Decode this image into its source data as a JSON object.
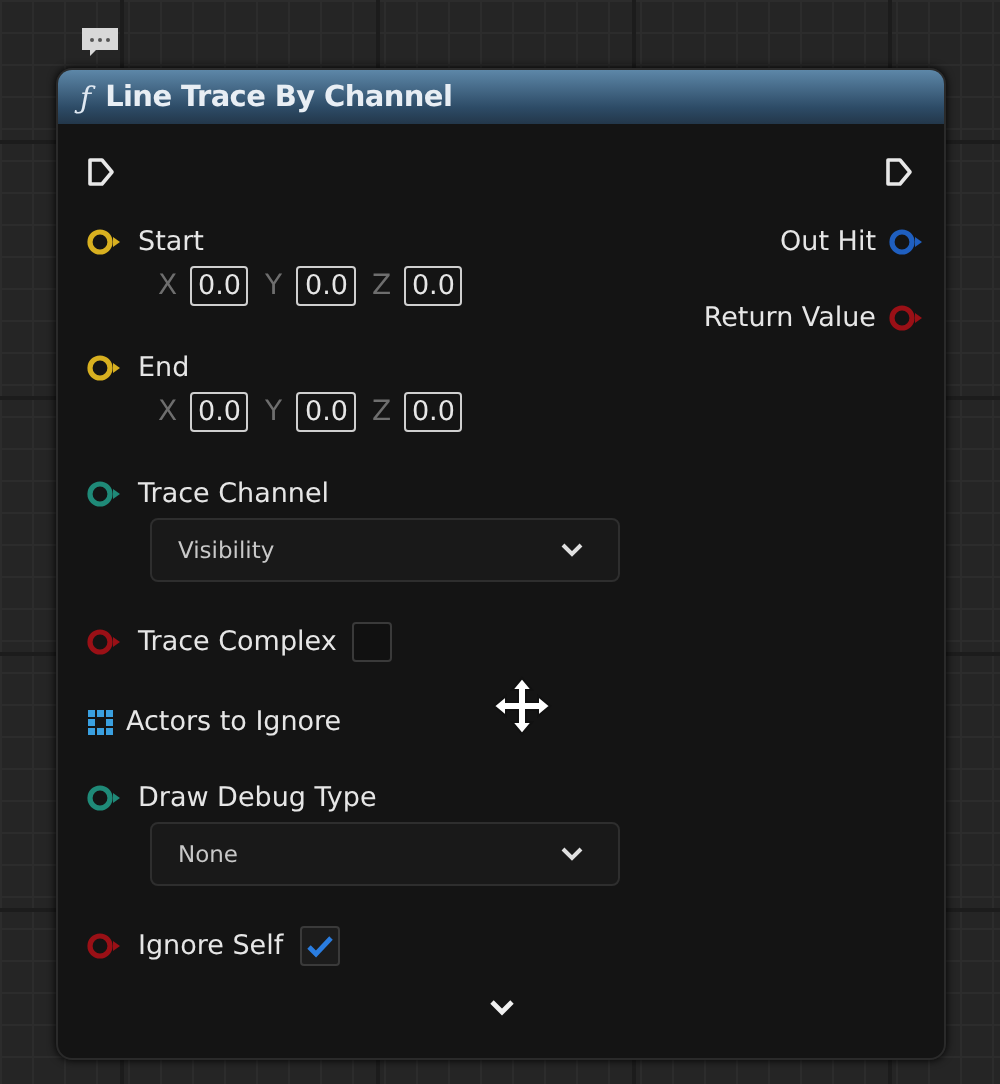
{
  "node": {
    "icon": "ƒ",
    "title": "Line Trace By Channel",
    "inputs": [
      {
        "kind": "vector",
        "label": "Start",
        "components": [
          {
            "axis": "X",
            "value": "0.0"
          },
          {
            "axis": "Y",
            "value": "0.0"
          },
          {
            "axis": "Z",
            "value": "0.0"
          }
        ]
      },
      {
        "kind": "vector",
        "label": "End",
        "components": [
          {
            "axis": "X",
            "value": "0.0"
          },
          {
            "axis": "Y",
            "value": "0.0"
          },
          {
            "axis": "Z",
            "value": "0.0"
          }
        ]
      },
      {
        "kind": "enum",
        "label": "Trace Channel",
        "value": "Visibility"
      },
      {
        "kind": "bool",
        "label": "Trace Complex",
        "checked": false
      },
      {
        "kind": "array",
        "label": "Actors to Ignore"
      },
      {
        "kind": "enum",
        "label": "Draw Debug Type",
        "value": "None"
      },
      {
        "kind": "bool",
        "label": "Ignore Self",
        "checked": true
      }
    ],
    "outputs": [
      {
        "kind": "struct",
        "label": "Out Hit"
      },
      {
        "kind": "bool",
        "label": "Return Value"
      }
    ]
  }
}
